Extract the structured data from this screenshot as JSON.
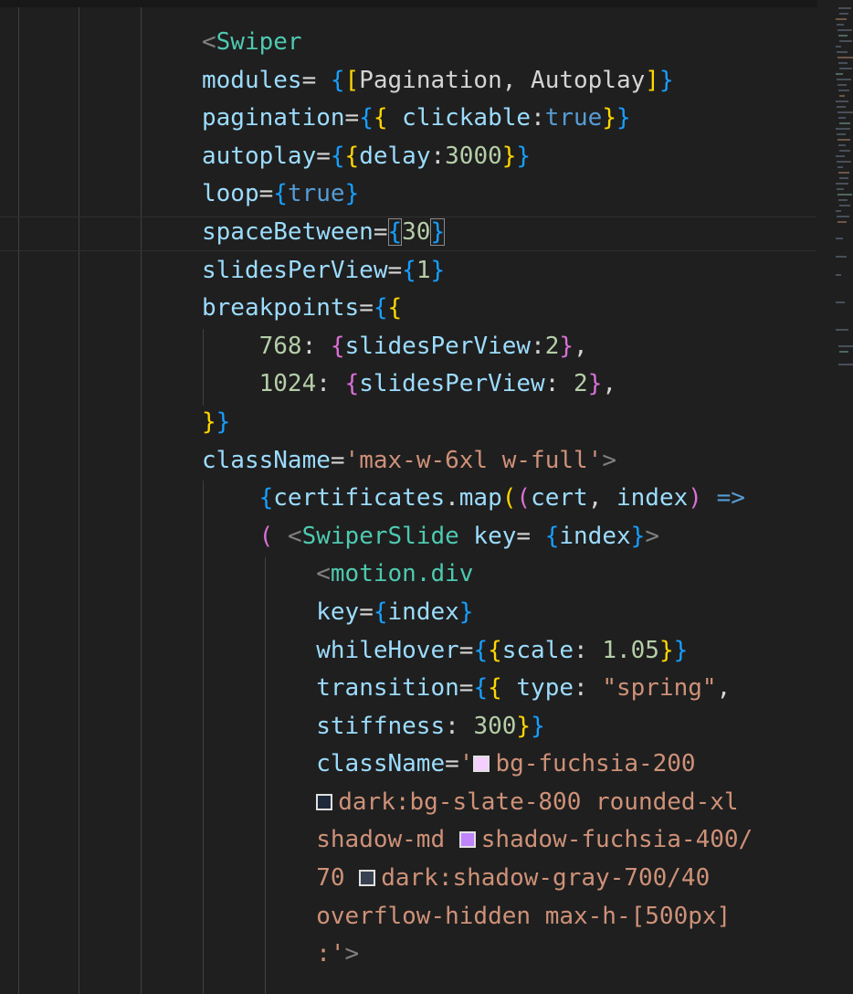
{
  "editor": {
    "lines": [
      [
        {
          "c": "ab",
          "t": "<"
        },
        {
          "c": "t",
          "t": "Swiper"
        }
      ],
      [
        {
          "c": "at",
          "t": "modules"
        },
        {
          "c": "op",
          "t": "= "
        },
        {
          "c": "b1",
          "t": "{"
        },
        {
          "c": "b2",
          "t": "["
        },
        {
          "c": "pun",
          "t": "Pagination, Autoplay"
        },
        {
          "c": "b2",
          "t": "]"
        },
        {
          "c": "b1",
          "t": "}"
        }
      ],
      [
        {
          "c": "at",
          "t": "pagination"
        },
        {
          "c": "op",
          "t": "="
        },
        {
          "c": "b1",
          "t": "{"
        },
        {
          "c": "b2",
          "t": "{"
        },
        {
          "c": "at",
          "t": " clickable"
        },
        {
          "c": "pun",
          "t": ":"
        },
        {
          "c": "kw",
          "t": "true"
        },
        {
          "c": "b2",
          "t": "}"
        },
        {
          "c": "b1",
          "t": "}"
        }
      ],
      [
        {
          "c": "at",
          "t": "autoplay"
        },
        {
          "c": "op",
          "t": "="
        },
        {
          "c": "b1",
          "t": "{"
        },
        {
          "c": "b2",
          "t": "{"
        },
        {
          "c": "at",
          "t": "delay"
        },
        {
          "c": "pun",
          "t": ":"
        },
        {
          "c": "nm",
          "t": "3000"
        },
        {
          "c": "b2",
          "t": "}"
        },
        {
          "c": "b1",
          "t": "}"
        }
      ],
      [
        {
          "c": "at",
          "t": "loop"
        },
        {
          "c": "op",
          "t": "="
        },
        {
          "c": "b1",
          "t": "{"
        },
        {
          "c": "kw",
          "t": "true"
        },
        {
          "c": "b1",
          "t": "}"
        }
      ],
      [
        {
          "c": "at",
          "t": "spaceBetween"
        },
        {
          "c": "op",
          "t": "="
        },
        {
          "c": "b1 bm",
          "t": "{"
        },
        {
          "c": "nm",
          "t": "30"
        },
        {
          "c": "b1 bm",
          "t": "}"
        }
      ],
      [
        {
          "c": "at",
          "t": "slidesPerView"
        },
        {
          "c": "op",
          "t": "="
        },
        {
          "c": "b1",
          "t": "{"
        },
        {
          "c": "nm",
          "t": "1"
        },
        {
          "c": "b1",
          "t": "}"
        }
      ],
      [
        {
          "c": "at",
          "t": "breakpoints"
        },
        {
          "c": "op",
          "t": "="
        },
        {
          "c": "b1",
          "t": "{"
        },
        {
          "c": "b2",
          "t": "{"
        }
      ],
      [
        {
          "c": "pun",
          "t": "    "
        },
        {
          "c": "nm",
          "t": "768"
        },
        {
          "c": "pun",
          "t": ": "
        },
        {
          "c": "b3",
          "t": "{"
        },
        {
          "c": "at",
          "t": "slidesPerView"
        },
        {
          "c": "pun",
          "t": ":"
        },
        {
          "c": "nm",
          "t": "2"
        },
        {
          "c": "b3",
          "t": "}"
        },
        {
          "c": "pun",
          "t": ","
        }
      ],
      [
        {
          "c": "pun",
          "t": "    "
        },
        {
          "c": "nm",
          "t": "1024"
        },
        {
          "c": "pun",
          "t": ": "
        },
        {
          "c": "b3",
          "t": "{"
        },
        {
          "c": "at",
          "t": "slidesPerView"
        },
        {
          "c": "pun",
          "t": ": "
        },
        {
          "c": "nm",
          "t": "2"
        },
        {
          "c": "b3",
          "t": "}"
        },
        {
          "c": "pun",
          "t": ","
        }
      ],
      [
        {
          "c": "b2",
          "t": "}"
        },
        {
          "c": "b1",
          "t": "}"
        }
      ],
      [
        {
          "c": "at",
          "t": "className"
        },
        {
          "c": "op",
          "t": "="
        },
        {
          "c": "st",
          "t": "'max-w-6xl w-full'"
        },
        {
          "c": "ab",
          "t": ">"
        }
      ],
      [
        {
          "c": "pun",
          "t": "    "
        },
        {
          "c": "b1",
          "t": "{"
        },
        {
          "c": "at",
          "t": "certificates"
        },
        {
          "c": "pun",
          "t": "."
        },
        {
          "c": "at",
          "t": "map"
        },
        {
          "c": "b2",
          "t": "("
        },
        {
          "c": "b3",
          "t": "("
        },
        {
          "c": "at",
          "t": "cert"
        },
        {
          "c": "pun",
          "t": ", "
        },
        {
          "c": "at",
          "t": "index"
        },
        {
          "c": "b3",
          "t": ")"
        },
        {
          "c": "pun",
          "t": " "
        },
        {
          "c": "kw",
          "t": "=>"
        }
      ],
      [
        {
          "c": "pun",
          "t": "    "
        },
        {
          "c": "b3",
          "t": "("
        },
        {
          "c": "pun",
          "t": " "
        },
        {
          "c": "ab",
          "t": "<"
        },
        {
          "c": "t",
          "t": "SwiperSlide"
        },
        {
          "c": "at",
          "t": " key"
        },
        {
          "c": "op",
          "t": "= "
        },
        {
          "c": "b1",
          "t": "{"
        },
        {
          "c": "at",
          "t": "index"
        },
        {
          "c": "b1",
          "t": "}"
        },
        {
          "c": "ab",
          "t": ">"
        }
      ],
      [
        {
          "c": "pun",
          "t": "        "
        },
        {
          "c": "ab",
          "t": "<"
        },
        {
          "c": "t",
          "t": "motion.div"
        }
      ],
      [
        {
          "c": "pun",
          "t": "        "
        },
        {
          "c": "at",
          "t": "key"
        },
        {
          "c": "op",
          "t": "="
        },
        {
          "c": "b1",
          "t": "{"
        },
        {
          "c": "at",
          "t": "index"
        },
        {
          "c": "b1",
          "t": "}"
        }
      ],
      [
        {
          "c": "pun",
          "t": "        "
        },
        {
          "c": "at",
          "t": "whileHover"
        },
        {
          "c": "op",
          "t": "="
        },
        {
          "c": "b1",
          "t": "{"
        },
        {
          "c": "b2",
          "t": "{"
        },
        {
          "c": "at",
          "t": "scale"
        },
        {
          "c": "pun",
          "t": ": "
        },
        {
          "c": "nm",
          "t": "1.05"
        },
        {
          "c": "b2",
          "t": "}"
        },
        {
          "c": "b1",
          "t": "}"
        }
      ],
      [
        {
          "c": "pun",
          "t": "        "
        },
        {
          "c": "at",
          "t": "transition"
        },
        {
          "c": "op",
          "t": "="
        },
        {
          "c": "b1",
          "t": "{"
        },
        {
          "c": "b2",
          "t": "{"
        },
        {
          "c": "at",
          "t": " type"
        },
        {
          "c": "pun",
          "t": ": "
        },
        {
          "c": "st",
          "t": "\"spring\""
        },
        {
          "c": "pun",
          "t": ","
        }
      ],
      [
        {
          "c": "pun",
          "t": "        "
        },
        {
          "c": "at",
          "t": "stiffness"
        },
        {
          "c": "pun",
          "t": ": "
        },
        {
          "c": "nm",
          "t": "300"
        },
        {
          "c": "b2",
          "t": "}"
        },
        {
          "c": "b1",
          "t": "}"
        }
      ],
      [
        {
          "c": "pun",
          "t": "        "
        },
        {
          "c": "at",
          "t": "className"
        },
        {
          "c": "op",
          "t": "="
        },
        {
          "c": "st",
          "t": "'"
        },
        {
          "sw": "#f5d0fe"
        },
        {
          "c": "st",
          "t": "bg-fuchsia-200"
        }
      ],
      [
        {
          "c": "pun",
          "t": "        "
        },
        {
          "sw": "#1e293b"
        },
        {
          "c": "st",
          "t": "dark:bg-slate-800 rounded-xl"
        }
      ],
      [
        {
          "c": "pun",
          "t": "        "
        },
        {
          "c": "st",
          "t": "shadow-md "
        },
        {
          "sw": "#c084fc"
        },
        {
          "c": "st",
          "t": "shadow-fuchsia-400/"
        }
      ],
      [
        {
          "c": "pun",
          "t": "        "
        },
        {
          "c": "st",
          "t": "70 "
        },
        {
          "sw": "#374151"
        },
        {
          "c": "st",
          "t": "dark:shadow-gray-700/40"
        }
      ],
      [
        {
          "c": "pun",
          "t": "        "
        },
        {
          "c": "st",
          "t": "overflow-hidden max-h-[500px]"
        }
      ],
      [
        {
          "c": "pun",
          "t": "        "
        },
        {
          "c": "st",
          "t": ":'"
        },
        {
          "c": "ab",
          "t": ">"
        }
      ]
    ]
  }
}
